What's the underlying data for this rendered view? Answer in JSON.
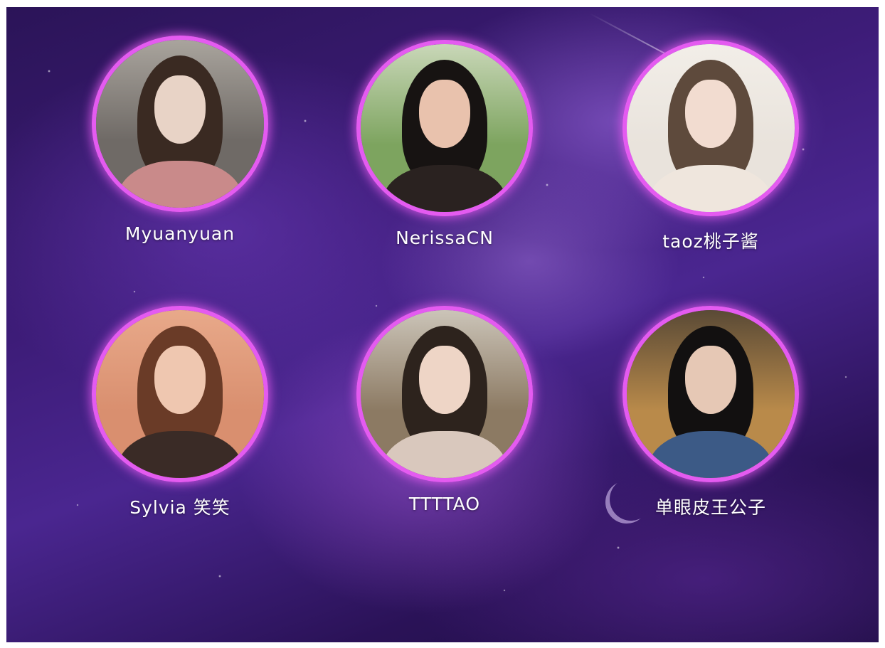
{
  "members": [
    {
      "name": "Myuanyuan",
      "photo_tones": {
        "bg": "#6f6a66",
        "top": "#a9a49d",
        "hair": "#3a2a22",
        "skin": "#e8d3c6",
        "outfit": "#c98a8a"
      }
    },
    {
      "name": "NerissaCN",
      "photo_tones": {
        "bg": "#7da45f",
        "top": "#c9d7b8",
        "hair": "#171312",
        "skin": "#e9c2ad",
        "outfit": "#2a2220"
      }
    },
    {
      "name": "taoz桃子酱",
      "photo_tones": {
        "bg": "#e9e3dc",
        "top": "#f2eee8",
        "hair": "#5e4a3c",
        "skin": "#f2dcd0",
        "outfit": "#efe6dd"
      }
    },
    {
      "name": "Sylvia 笑笑",
      "photo_tones": {
        "bg": "#d98f6f",
        "top": "#e8a98a",
        "hair": "#6a3b27",
        "skin": "#efc7b0",
        "outfit": "#3a2b26"
      }
    },
    {
      "name": "TTTTAO",
      "photo_tones": {
        "bg": "#8c7a63",
        "top": "#cbc4b8",
        "hair": "#2d231d",
        "skin": "#eed5c6",
        "outfit": "#d9c8bd"
      }
    },
    {
      "name": "单眼皮王公子",
      "photo_tones": {
        "bg": "#b98a4a",
        "top": "#5a4a36",
        "hair": "#121010",
        "skin": "#e6c8b5",
        "outfit": "#3c5a86"
      }
    }
  ]
}
